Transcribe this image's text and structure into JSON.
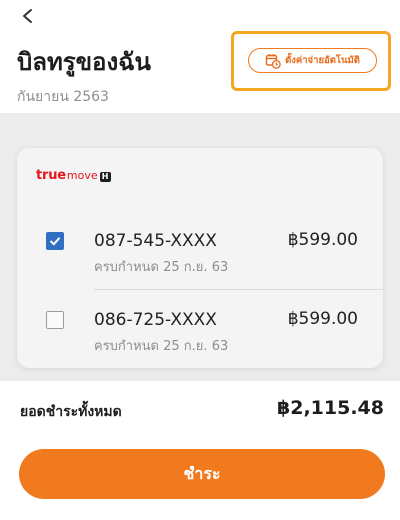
{
  "header": {
    "title": "บิลทรูของฉัน",
    "subtitle": "กันยายน 2563",
    "autopay_label": "ตั้งค่าจ่ายอัตโนมัติ"
  },
  "card": {
    "brand": {
      "true_text": "true",
      "move_text": "move",
      "h_text": "H"
    },
    "bills": [
      {
        "phone": "087-545-XXXX",
        "due": "ครบกำหนด 25 ก.ย. 63",
        "amount": "฿599.00",
        "checked": true
      },
      {
        "phone": "086-725-XXXX",
        "due": "ครบกำหนด 25 ก.ย. 63",
        "amount": "฿599.00",
        "checked": false
      }
    ]
  },
  "footer": {
    "total_label": "ยอดชำระทั้งหมด",
    "total_value": "฿2,115.48",
    "pay_label": "ชำระ"
  },
  "colors": {
    "accent": "#f07a1d",
    "highlight_border": "#f5a623",
    "checkbox_checked": "#2f6fc3",
    "brand_red": "#e4151b"
  },
  "icons": {
    "back": "chevron-left-icon",
    "autopay": "calendar-clock-icon",
    "check": "checkmark-icon"
  }
}
